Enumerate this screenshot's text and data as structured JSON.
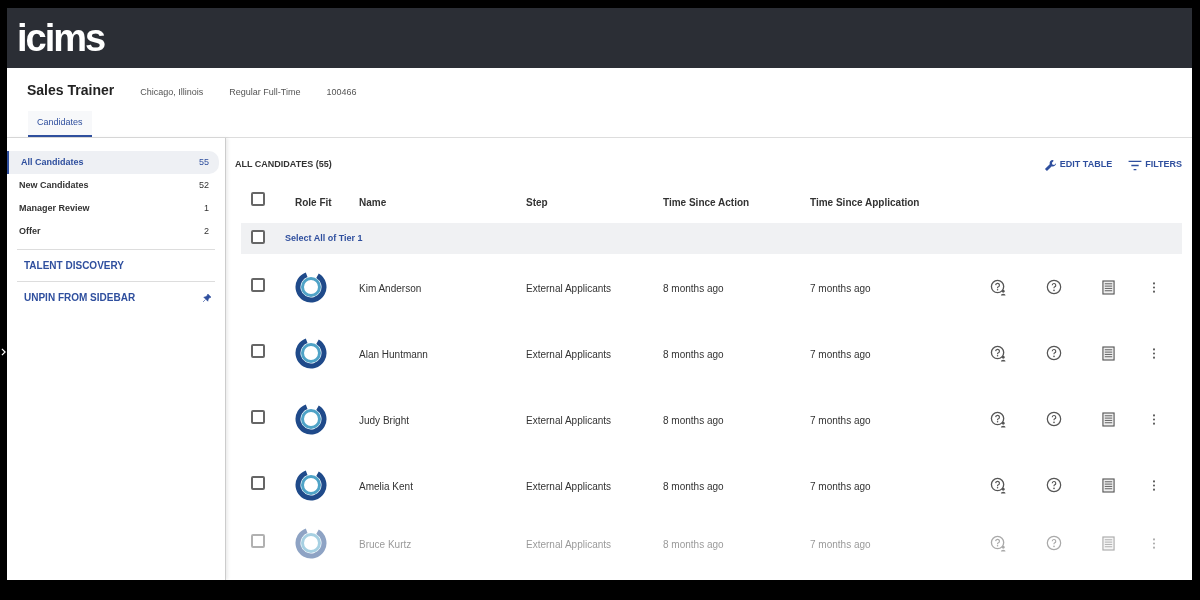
{
  "header": {
    "logo": "icims"
  },
  "job": {
    "title": "Sales Trainer",
    "location": "Chicago, Illinois",
    "type": "Regular Full-Time",
    "id": "100466"
  },
  "tabs": [
    {
      "label": "Candidates",
      "selected": true
    }
  ],
  "sidebar": {
    "items": [
      {
        "label": "All Candidates",
        "count": "55",
        "selected": true
      },
      {
        "label": "New Candidates",
        "count": "52",
        "selected": false
      },
      {
        "label": "Manager Review",
        "count": "1",
        "selected": false
      },
      {
        "label": "Offer",
        "count": "2",
        "selected": false
      }
    ],
    "links": [
      {
        "label": "TALENT DISCOVERY",
        "kind": "plain"
      },
      {
        "label": "UNPIN FROM SIDEBAR",
        "kind": "pin"
      }
    ]
  },
  "table": {
    "title": "ALL CANDIDATES (55)",
    "actions": [
      {
        "label": "EDIT TABLE",
        "kind": "edit"
      },
      {
        "label": "FILTERS",
        "kind": "filter"
      }
    ],
    "columns": [
      "Role Fit",
      "Name",
      "Step",
      "Time Since Action",
      "Time Since Application"
    ],
    "header_checkbox": {
      "checked": false
    },
    "select_all": {
      "label": "Select All of Tier 1",
      "checked": false
    },
    "rows": [
      {
        "name": "Kim Anderson",
        "step": "External Applicants",
        "time_action": "8 months ago",
        "time_application": "7 months ago",
        "checked": false,
        "faded": false
      },
      {
        "name": "Alan Huntmann",
        "step": "External Applicants",
        "time_action": "8 months ago",
        "time_application": "7 months ago",
        "checked": false,
        "faded": false
      },
      {
        "name": "Judy Bright",
        "step": "External Applicants",
        "time_action": "8 months ago",
        "time_application": "7 months ago",
        "checked": false,
        "faded": false
      },
      {
        "name": "Amelia Kent",
        "step": "External Applicants",
        "time_action": "8 months ago",
        "time_application": "7 months ago",
        "checked": false,
        "faded": false
      },
      {
        "name": "Bruce Kurtz",
        "step": "External Applicants",
        "time_action": "8 months ago",
        "time_application": "7 months ago",
        "checked": false,
        "faded": true
      }
    ]
  }
}
